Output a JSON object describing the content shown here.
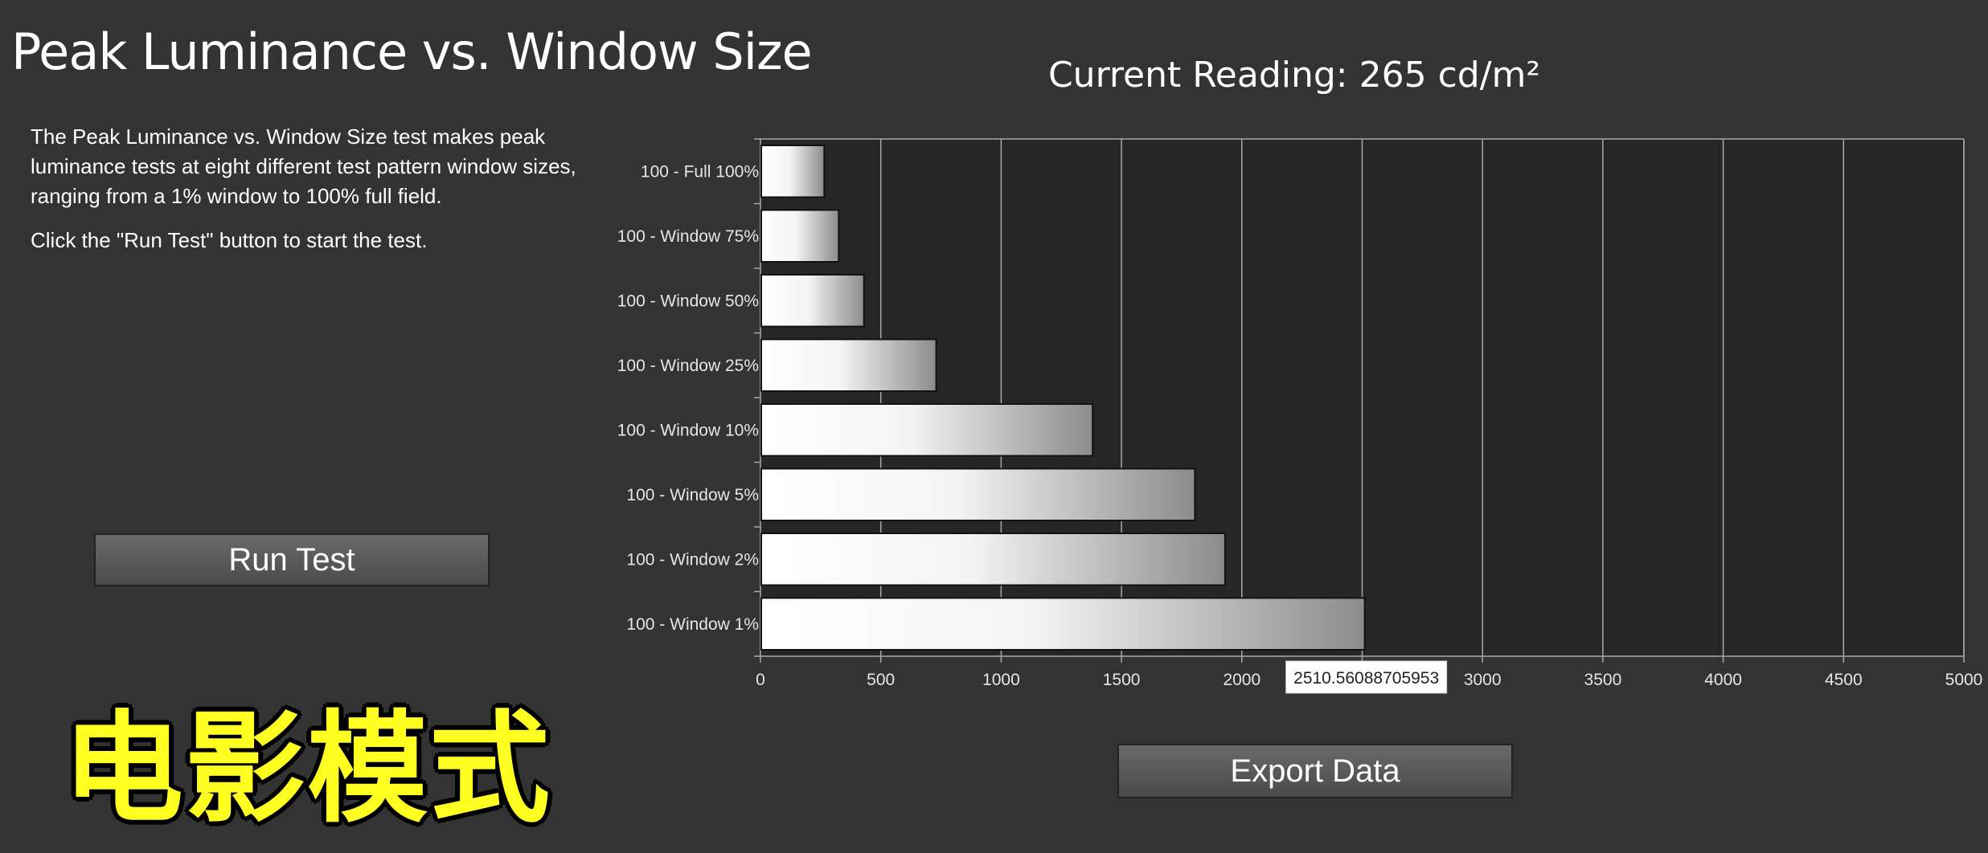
{
  "header": {
    "title": "Peak Luminance vs. Window Size",
    "current_reading": "Current Reading: 265 cd/m²"
  },
  "description": {
    "paragraph1": "The Peak Luminance vs. Window Size test makes peak luminance tests at eight different test pattern window sizes, ranging from a 1% window to 100% full field.",
    "paragraph2": "Click the \"Run Test\" button to start the test."
  },
  "buttons": {
    "run_test": "Run Test",
    "export_data": "Export  Data"
  },
  "overlay": {
    "banner_text": "电影模式"
  },
  "chart_data": {
    "type": "bar",
    "orientation": "horizontal",
    "categories": [
      "100 - Full  100%",
      "100 - Window 75%",
      "100 - Window 50%",
      "100 - Window 25%",
      "100 - Window 10%",
      "100 - Window  5%",
      "100 - Window  2%",
      "100 - Window  1%"
    ],
    "values": [
      265,
      325,
      430,
      730,
      1380,
      1805,
      1930,
      2510.56088705953
    ],
    "xlim": [
      0,
      5000
    ],
    "xticks": [
      0,
      500,
      1000,
      1500,
      2000,
      2500,
      3000,
      3500,
      4000,
      4500,
      5000
    ],
    "tooltip": "2510.56088705953",
    "grid": "vertical",
    "colors": {
      "plot_bg": "#262626",
      "grid": "#a8a8a8",
      "bar_start": "#ffffff",
      "bar_end": "#8c8c8c",
      "bar_border": "#111111"
    }
  }
}
